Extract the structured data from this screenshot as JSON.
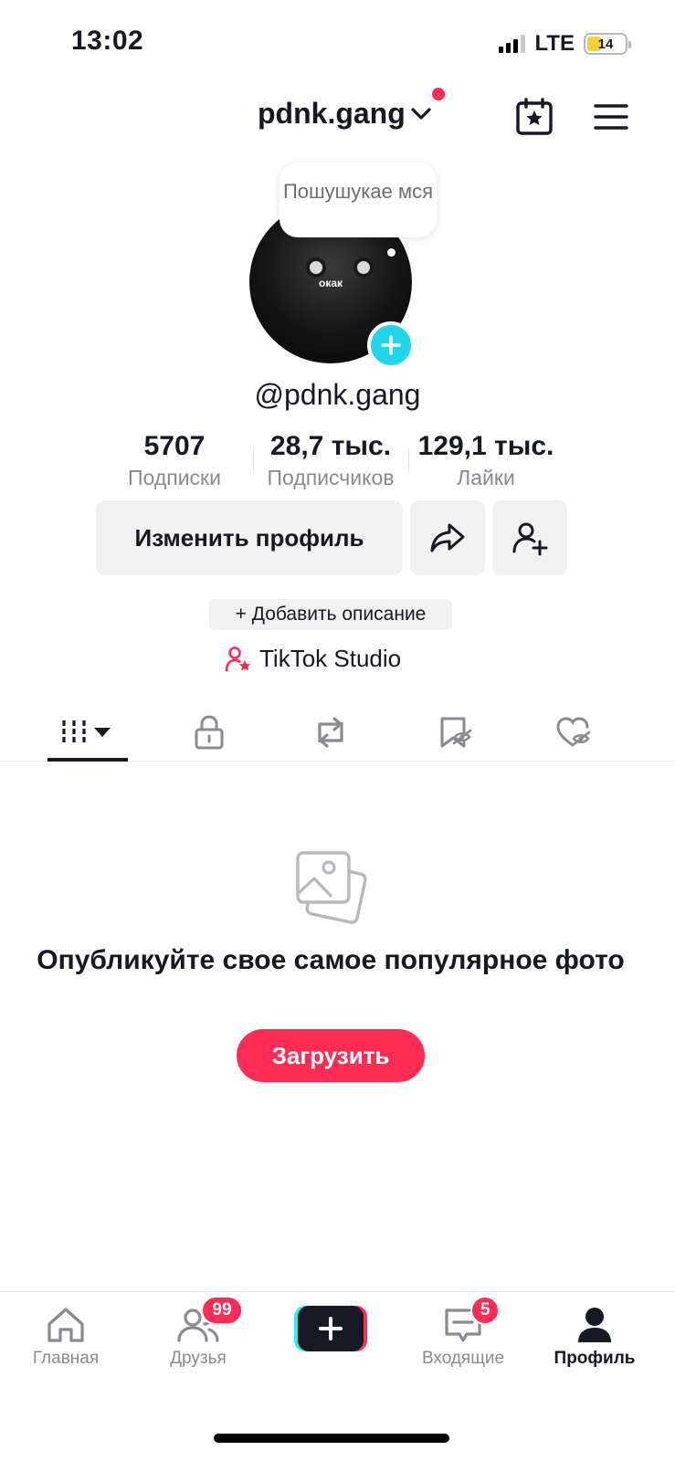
{
  "status_bar": {
    "time": "13:02",
    "network": "LTE",
    "battery_level": "14"
  },
  "header": {
    "username": "pdnk.gang"
  },
  "profile": {
    "status_bubble": "Пошушукае мся",
    "avatar_caption": "окак",
    "handle": "@pdnk.gang"
  },
  "stats": [
    {
      "value": "5707",
      "label": "Подписки"
    },
    {
      "value": "28,7 тыс.",
      "label": "Подписчиков"
    },
    {
      "value": "129,1 тыс.",
      "label": "Лайки"
    }
  ],
  "actions": {
    "edit_profile": "Изменить профиль",
    "add_description": "+ Добавить описание",
    "studio": "TikTok Studio"
  },
  "tabs": [
    {
      "icon": "grid-icon"
    },
    {
      "icon": "lock-icon"
    },
    {
      "icon": "repost-icon"
    },
    {
      "icon": "saved-icon"
    },
    {
      "icon": "liked-icon"
    }
  ],
  "empty_state": {
    "title": "Опубликуйте свое самое популярное фото",
    "button": "Загрузить"
  },
  "bottom_nav": {
    "home": "Главная",
    "friends": "Друзья",
    "friends_badge": "99",
    "inbox": "Входящие",
    "inbox_badge": "5",
    "profile": "Профиль"
  },
  "colors": {
    "accent": "#fe2c55",
    "cyan": "#20d5ec",
    "text": "#161823",
    "muted": "#8a8b91",
    "button_bg": "#f1f1f2"
  }
}
